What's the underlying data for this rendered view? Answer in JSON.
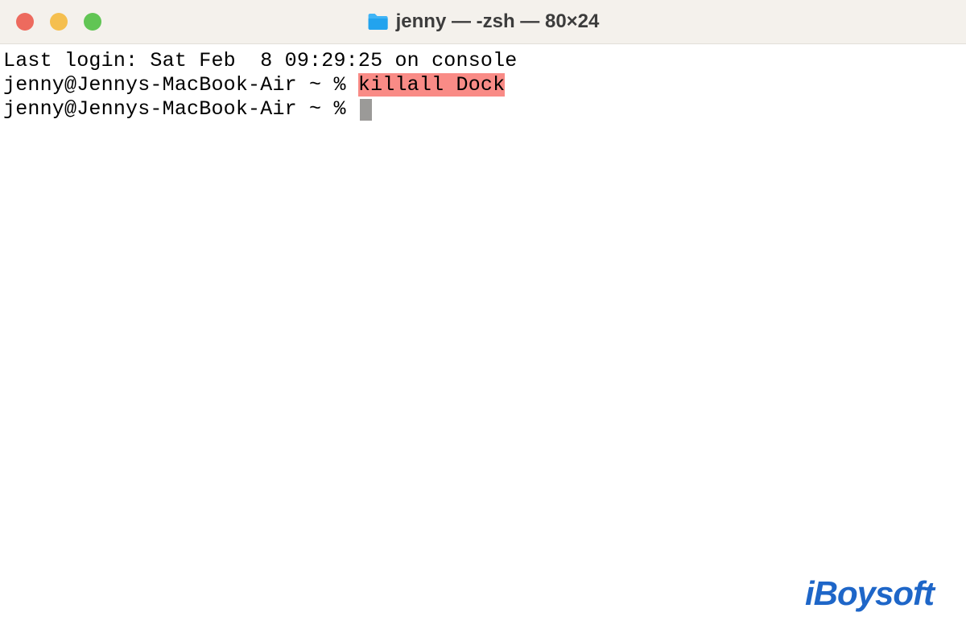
{
  "window": {
    "title": "jenny — -zsh — 80×24"
  },
  "terminal": {
    "line1": "Last login: Sat Feb  8 09:29:25 on console",
    "prompt": "jenny@Jennys-MacBook-Air ~ % ",
    "command": "killall Dock",
    "prompt2": "jenny@Jennys-MacBook-Air ~ % "
  },
  "watermark": "iBoysoft"
}
